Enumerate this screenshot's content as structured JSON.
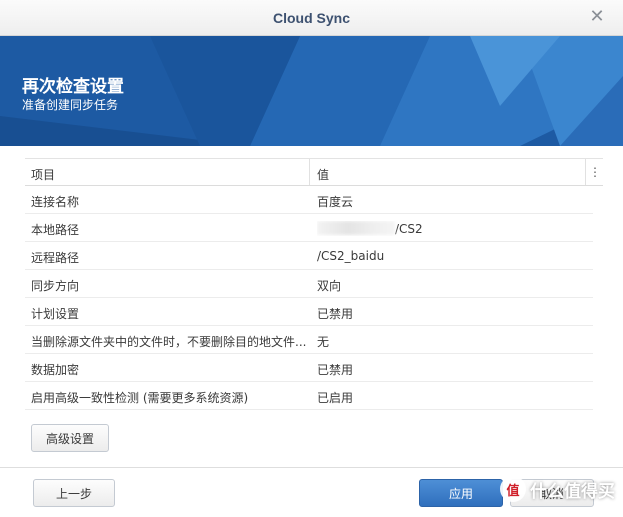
{
  "window": {
    "title": "Cloud Sync",
    "close_icon": "close-icon"
  },
  "banner": {
    "title": "再次检查设置",
    "subtitle": "准备创建同步任务",
    "color": "#1f5fa8"
  },
  "table": {
    "headers": {
      "key": "项目",
      "value": "值"
    },
    "rows": [
      {
        "key": "连接名称",
        "value": "百度云"
      },
      {
        "key": "本地路径",
        "value": "/CS2",
        "redacted": true
      },
      {
        "key": "远程路径",
        "value": "/CS2_baidu"
      },
      {
        "key": "同步方向",
        "value": "双向"
      },
      {
        "key": "计划设置",
        "value": "已禁用"
      },
      {
        "key": "当删除源文件夹中的文件时，不要删除目的地文件...",
        "value": "无"
      },
      {
        "key": "数据加密",
        "value": "已禁用"
      },
      {
        "key": "启用高级一致性检测 (需要更多系统资源)",
        "value": "已启用"
      }
    ]
  },
  "buttons": {
    "advanced": "高级设置",
    "previous": "上一步",
    "apply": "应用",
    "cancel": "取消"
  },
  "watermark": {
    "badge": "值",
    "text": "什么值得买"
  }
}
